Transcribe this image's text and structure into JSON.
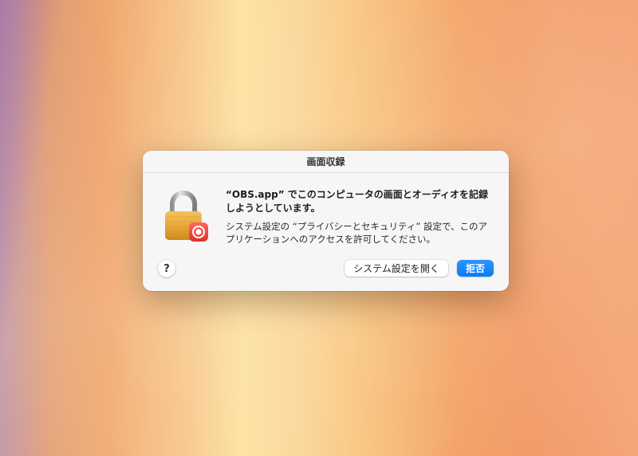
{
  "dialog": {
    "title": "画面収録",
    "headline": "“OBS.app” でこのコンピュータの画面とオーディオを記録しようとしています。",
    "body": "システム設定の “プライバシーとセキュリティ” 設定で、このアプリケーションへのアクセスを許可してください。",
    "icon": "lock-icon",
    "badge_icon": "screen-record-icon",
    "help_label": "?",
    "open_settings_label": "システム設定を開く",
    "deny_label": "拒否"
  },
  "colors": {
    "primary_button": "#0a7bf5",
    "lock_body": "#e9a93a",
    "badge": "#f0453a"
  }
}
